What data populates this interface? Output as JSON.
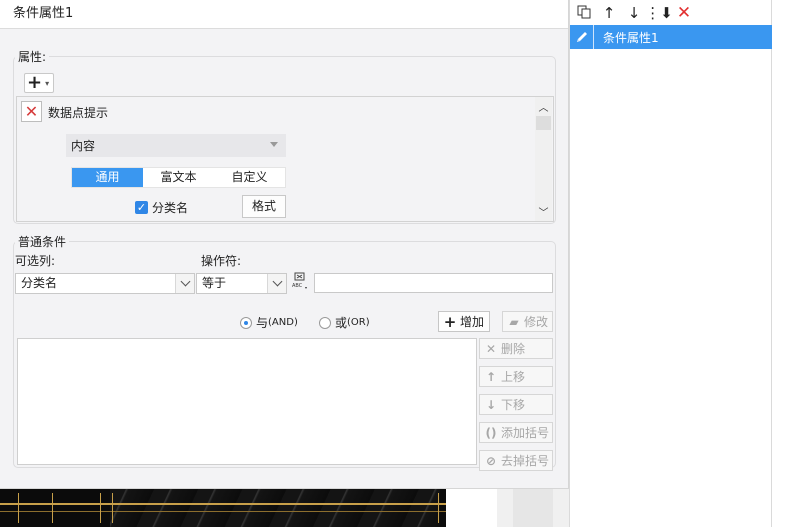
{
  "dialog": {
    "title": "条件属性1"
  },
  "attributes": {
    "group_label": "属性:",
    "add_button": "+",
    "item_name": "数据点提示",
    "content_select": "内容",
    "tabs": [
      "通用",
      "富文本",
      "自定义"
    ],
    "active_tab": "通用",
    "category_checkbox_label": "分类名",
    "category_checked": true,
    "format_button": "格式"
  },
  "conditions": {
    "group_label": "普通条件",
    "column_label": "可选列:",
    "column_value": "分类名",
    "operator_label": "操作符:",
    "operator_value": "等于",
    "value_input": "",
    "and_label": "与",
    "and_code": "(AND)",
    "or_label": "或",
    "or_code": "(OR)",
    "logic_selected": "AND",
    "add_button": "增加",
    "modify_button": "修改",
    "delete_button": "删除",
    "move_up_button": "上移",
    "move_down_button": "下移",
    "add_bracket_button": "添加括号",
    "remove_bracket_button": "去掉括号"
  },
  "right_panel": {
    "items": [
      "条件属性1"
    ],
    "selected_index": 0
  },
  "colors": {
    "accent": "#3a97f0",
    "delete_red": "#e23030"
  }
}
